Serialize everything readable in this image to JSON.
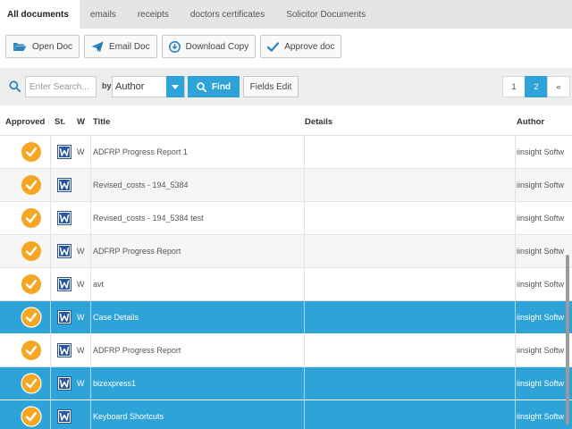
{
  "tabs": [
    {
      "label": "All documents",
      "active": true
    },
    {
      "label": "emails",
      "active": false
    },
    {
      "label": "receipts",
      "active": false
    },
    {
      "label": "doctors certificates",
      "active": false
    },
    {
      "label": "Solicitor Documents",
      "active": false
    }
  ],
  "toolbar": {
    "open_label": "Open Doc",
    "email_label": "Email Doc",
    "download_label": "Download Copy",
    "approve_label": "Approve doc"
  },
  "search": {
    "placeholder": "Enter Search...",
    "by_label": "by",
    "field_value": "Author",
    "find_label": "Find",
    "fields_edit_label": "Fields Edit"
  },
  "pagination": {
    "pages": [
      "1",
      "2"
    ],
    "current": "2",
    "prev_symbol": "«"
  },
  "grid": {
    "columns": {
      "approved": "Approved",
      "status": "St.",
      "w": "W",
      "title": "Title",
      "details": "Details",
      "author": "Author"
    },
    "rows": [
      {
        "approved": true,
        "w": "W",
        "title": "ADFRP Progress Report 1",
        "details": "",
        "author": "iinsight Softw",
        "selected": false
      },
      {
        "approved": true,
        "w": "",
        "title": "Revised_costs - 194_5384",
        "details": "",
        "author": "iinsight Softw",
        "selected": false
      },
      {
        "approved": true,
        "w": "",
        "title": "Revised_costs - 194_5384 test",
        "details": "",
        "author": "iinsight Softw",
        "selected": false
      },
      {
        "approved": true,
        "w": "W",
        "title": "ADFRP Progress Report",
        "details": "",
        "author": "iinsight Softw",
        "selected": false
      },
      {
        "approved": true,
        "w": "W",
        "title": "avt",
        "details": "",
        "author": "iinsight Softw",
        "selected": false
      },
      {
        "approved": true,
        "w": "W",
        "title": "Case Details",
        "details": "",
        "author": "iinsight Softw",
        "selected": true
      },
      {
        "approved": true,
        "w": "W",
        "title": "ADFRP Progress Report",
        "details": "",
        "author": "iinsight Softw",
        "selected": false
      },
      {
        "approved": true,
        "w": "W",
        "title": "bizexpress1",
        "details": "",
        "author": "iinsight Softw",
        "selected": true
      },
      {
        "approved": true,
        "w": "",
        "title": "Keyboard Shortcuts",
        "details": "",
        "author": "iinsight Softw",
        "selected": true
      }
    ]
  },
  "colors": {
    "accent": "#2ea3d8",
    "approved_badge": "#f5a623",
    "word_icon": "#2b579a"
  },
  "icons": {
    "open": "folder-open-icon",
    "email": "paper-plane-icon",
    "download": "download-icon",
    "approve": "checkmark-icon",
    "search": "search-icon",
    "word": "word-document-icon"
  }
}
